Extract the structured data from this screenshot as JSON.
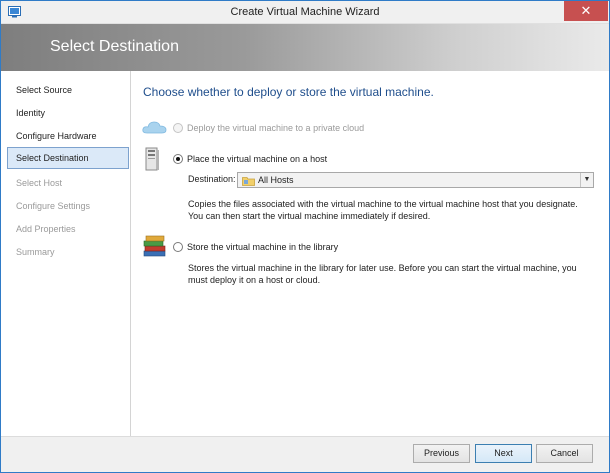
{
  "window": {
    "title": "Create Virtual Machine Wizard",
    "close_glyph": "✕"
  },
  "header": {
    "title": "Select Destination"
  },
  "sidebar": {
    "items": [
      {
        "label": "Select Source",
        "state": "enabled"
      },
      {
        "label": "Identity",
        "state": "enabled"
      },
      {
        "label": "Configure Hardware",
        "state": "enabled"
      },
      {
        "label": "Select Destination",
        "state": "selected"
      },
      {
        "label": "Select Host",
        "state": "disabled"
      },
      {
        "label": "Configure Settings",
        "state": "disabled"
      },
      {
        "label": "Add Properties",
        "state": "disabled"
      },
      {
        "label": "Summary",
        "state": "disabled"
      }
    ]
  },
  "main": {
    "heading": "Choose whether to deploy or store the virtual machine.",
    "options": [
      {
        "label": "Deploy the virtual machine to a private cloud",
        "icon": "cloud-icon",
        "selected": false,
        "enabled": false
      },
      {
        "label": "Place the virtual machine on a host",
        "icon": "server-icon",
        "selected": true,
        "enabled": true
      },
      {
        "label": "Store the virtual machine in the library",
        "icon": "library-books-icon",
        "selected": false,
        "enabled": true
      }
    ],
    "destination": {
      "label": "Destination:",
      "value": "All Hosts",
      "icon": "folder-icon"
    },
    "host_desc_line1": "Copies the files associated with the virtual machine to the virtual machine host that you designate.",
    "host_desc_line2": "You can then start the virtual machine immediately if desired.",
    "library_desc_line1": "Stores the virtual machine in the library for later use. Before you can start the virtual machine, you",
    "library_desc_line2": "must deploy it on a host or cloud."
  },
  "footer": {
    "previous": "Previous",
    "next": "Next",
    "cancel": "Cancel"
  },
  "colors": {
    "heading": "#1f4e8c",
    "selection": "#dbe9f8",
    "close": "#c75050"
  }
}
